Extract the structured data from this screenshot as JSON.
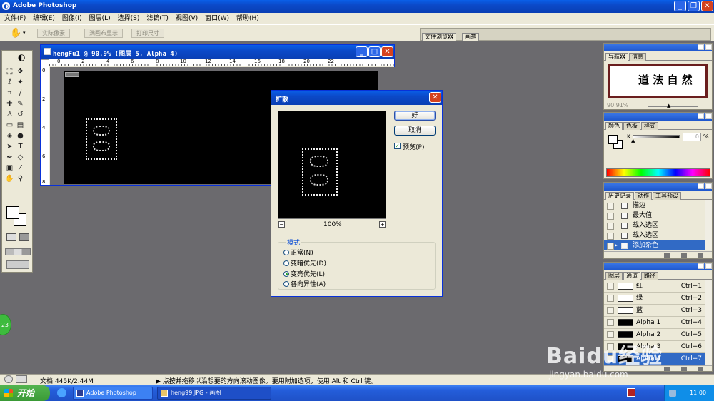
{
  "app_title": "Adobe Photoshop",
  "menu": [
    "文件(F)",
    "编辑(E)",
    "图像(I)",
    "图层(L)",
    "选择(S)",
    "滤镜(T)",
    "视图(V)",
    "窗口(W)",
    "帮助(H)"
  ],
  "options_bar": {
    "buttons": [
      "实际像素",
      "满画布显示",
      "打印尺寸"
    ],
    "right_tabs": [
      "文件浏览器",
      "画笔"
    ]
  },
  "document": {
    "title": "hengFu1 @ 90.9% (图层 5, Alpha 4)",
    "ruler_top": [
      "0",
      "2",
      "4",
      "6",
      "8",
      "10",
      "12",
      "14",
      "16",
      "18",
      "20",
      "22"
    ],
    "ruler_left": [
      "0",
      "2",
      "4",
      "6",
      "8"
    ]
  },
  "dialog": {
    "title": "扩散",
    "ok": "好",
    "cancel": "取消",
    "preview": "预览(P)",
    "zoom": "100%",
    "zoom_minus": "−",
    "zoom_plus": "+",
    "mode_legend": "模式",
    "modes": [
      {
        "label": "正常(N)",
        "selected": false
      },
      {
        "label": "变暗优先(D)",
        "selected": false
      },
      {
        "label": "变亮优先(L)",
        "selected": true
      },
      {
        "label": "各向异性(A)",
        "selected": false
      }
    ]
  },
  "navigator": {
    "tabs": [
      "导航器",
      "信息"
    ],
    "zoom": "90.91%",
    "preview_text": "道 法 自 然"
  },
  "color_panel": {
    "tabs": [
      "颜色",
      "色板",
      "样式"
    ],
    "k_label": "K",
    "k_value": "0",
    "percent": "%"
  },
  "history": {
    "tabs": [
      "历史记录",
      "动作",
      "工具预设"
    ],
    "items": [
      "描边",
      "最大值",
      "载入选区",
      "载入选区",
      "添加杂色"
    ],
    "selected_index": 4
  },
  "channels": {
    "tabs": [
      "图层",
      "通道",
      "路径"
    ],
    "rows": [
      {
        "name": "红",
        "shortcut": "Ctrl+1"
      },
      {
        "name": "绿",
        "shortcut": "Ctrl+2"
      },
      {
        "name": "蓝",
        "shortcut": "Ctrl+3"
      },
      {
        "name": "Alpha 1",
        "shortcut": "Ctrl+4"
      },
      {
        "name": "Alpha 2",
        "shortcut": "Ctrl+5"
      },
      {
        "name": "Alpha 3",
        "shortcut": "Ctrl+6"
      },
      {
        "name": "Alpha 4",
        "shortcut": "Ctrl+7"
      }
    ]
  },
  "status": {
    "doc": "文档:445K/2.44M",
    "hint": "▶ 点按并拖移以沿想要的方向滚动图像。要用附加选项，使用 Alt 和 Ctrl 键。"
  },
  "taskbar": {
    "start": "开始",
    "tasks": [
      "Adobe Photoshop",
      "heng99.JPG - 画图"
    ],
    "time": "11:00"
  },
  "watermark": {
    "brand": "Baidu经验",
    "url": "jingyan.baidu.com"
  },
  "desktop_badge": "23"
}
